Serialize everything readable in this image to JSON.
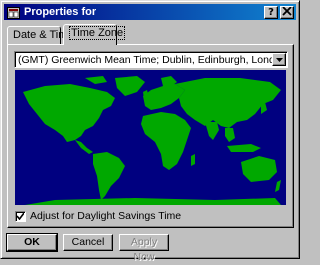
{
  "window": {
    "title": "Properties for",
    "help_button": "?",
    "close_button": "X"
  },
  "tabs": [
    {
      "label": "Date & Time",
      "active": false
    },
    {
      "label": "Time Zone",
      "active": true
    }
  ],
  "timezone": {
    "selected": "(GMT) Greenwich Mean Time; Dublin, Edinburgh, London"
  },
  "map": {
    "ocean_color": "#000080",
    "land_color": "#00a800"
  },
  "daylight": {
    "label": "Adjust for Daylight Savings Time",
    "checked": true
  },
  "buttons": {
    "ok": "OK",
    "cancel": "Cancel",
    "apply": "Apply Now"
  }
}
